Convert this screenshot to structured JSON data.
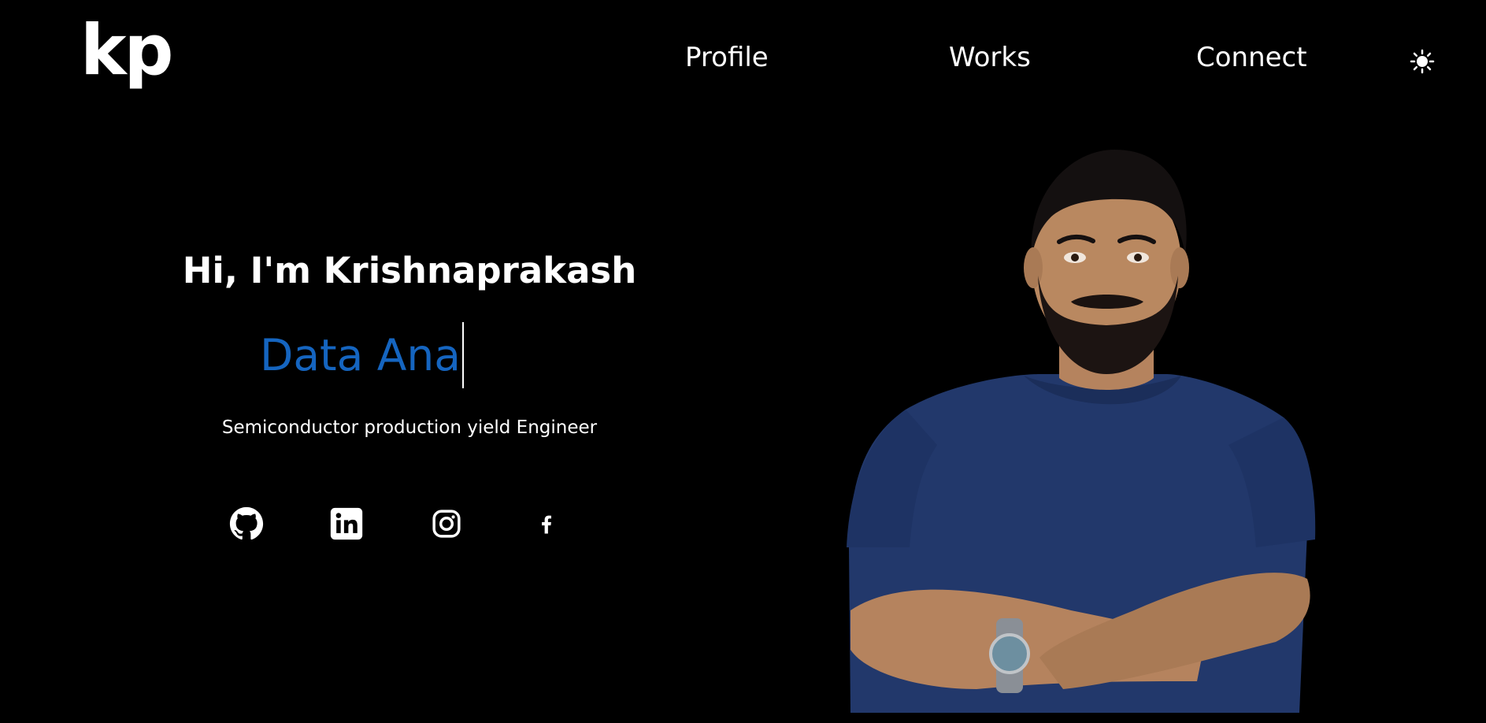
{
  "header": {
    "logo": "kp",
    "nav": {
      "profile": "Profile",
      "works": "Works",
      "connect": "Connect"
    },
    "theme_toggle_icon": "sun-icon"
  },
  "hero": {
    "greeting": "Hi, I'm Krishnaprakash",
    "typed_role": "Data Ana",
    "subtitle": "Semiconductor production yield Engineer",
    "socials": [
      "github-icon",
      "linkedin-icon",
      "instagram-icon",
      "facebook-icon"
    ],
    "portrait_icon": "profile-photo"
  },
  "colors": {
    "background": "#000000",
    "text": "#ffffff",
    "accent": "#1565c0",
    "shirt": "#22386b"
  }
}
